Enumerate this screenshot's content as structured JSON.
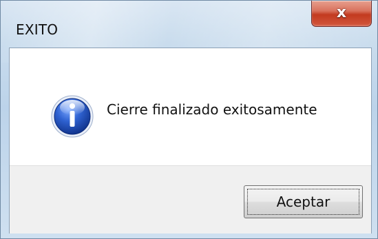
{
  "window": {
    "title": "EXITO",
    "close_label": "x"
  },
  "dialog": {
    "icon": "info-icon",
    "message": "Cierre finalizado exitosamente",
    "ok_label": "Aceptar"
  },
  "colors": {
    "info_blue": "#1f4fb8",
    "close_red": "#c33a1f",
    "footer_gray": "#f0f0f0"
  }
}
